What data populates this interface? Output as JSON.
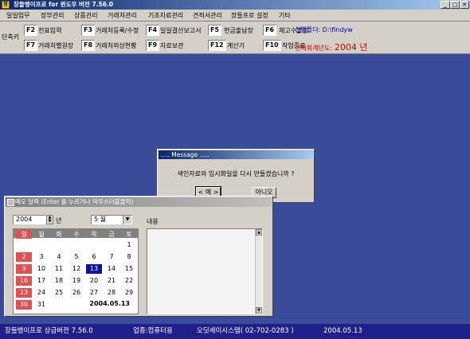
{
  "window": {
    "title": "장들뱅이프로 for 윈도우 버전 7.56.0",
    "icon_text": "장",
    "min_label": "_",
    "max_label": "□",
    "close_label": "✕"
  },
  "menu": [
    "일일업무",
    "장부관리",
    "상품관리",
    "거래처관리",
    "기초자료관리",
    "견적서관리",
    "장들프로 설정",
    "기타"
  ],
  "toolbar": {
    "quick_label": "단축키",
    "row1": [
      {
        "key": "F2",
        "label": "전표입력"
      },
      {
        "key": "F3",
        "label": "거래처등록/수정"
      },
      {
        "key": "F4",
        "label": "일일결산보고서"
      },
      {
        "key": "F5",
        "label": "현금출납장"
      },
      {
        "key": "F6",
        "label": "재고수불장"
      }
    ],
    "row2": [
      {
        "key": "F7",
        "label": "거래처별원장"
      },
      {
        "key": "F8",
        "label": "거래처외상현황"
      },
      {
        "key": "F9",
        "label": "자료보관"
      },
      {
        "key": "F12",
        "label": "계산기"
      },
      {
        "key": "F10",
        "label": "작업종료"
      }
    ],
    "exec_folder": "실행폴더: D:\\findyw",
    "fiscal_label": "현재회계년도:",
    "fiscal_year": "2004 년"
  },
  "dialog": {
    "title": "..... Message .....",
    "message": "색인자료와 임시화일을 다시 만들겠습니까 ?",
    "yes": "< 예 >",
    "no": "아니오 n"
  },
  "memo": {
    "title": "메모 달력 (Enter 를 누르거나 마우스더블클릭)",
    "year": "2004",
    "year_suffix": "년",
    "month": "5 월",
    "weekdays": [
      "일",
      "월",
      "화",
      "수",
      "목",
      "금",
      "토"
    ],
    "days": [
      [
        "",
        "",
        "",
        "",
        "",
        "",
        "1"
      ],
      [
        "2",
        "3",
        "4",
        "5",
        "6",
        "7",
        "8"
      ],
      [
        "9",
        "10",
        "11",
        "12",
        "13",
        "14",
        "15"
      ],
      [
        "16",
        "17",
        "18",
        "19",
        "20",
        "21",
        "22"
      ],
      [
        "23",
        "24",
        "25",
        "26",
        "27",
        "28",
        "29"
      ],
      [
        "30",
        "31",
        "",
        "",
        "",
        "",
        ""
      ]
    ],
    "selected_day": "13",
    "date_display": "2004.05.13",
    "content_label": "내용"
  },
  "status": {
    "program": "장들뱅이프로 상급버전 7.56.0",
    "business": "업종:컴퓨터용",
    "company": "오딧세이시스템( 02-702-0283 )",
    "date": "2004.05.13"
  },
  "colors": {
    "desktop": "#3a4b9c",
    "statusbar": "#20208a",
    "fiscal_text": "#d00000",
    "exec_text": "#0000c0",
    "sunday": "#e05050",
    "selected": "#1010a0"
  }
}
